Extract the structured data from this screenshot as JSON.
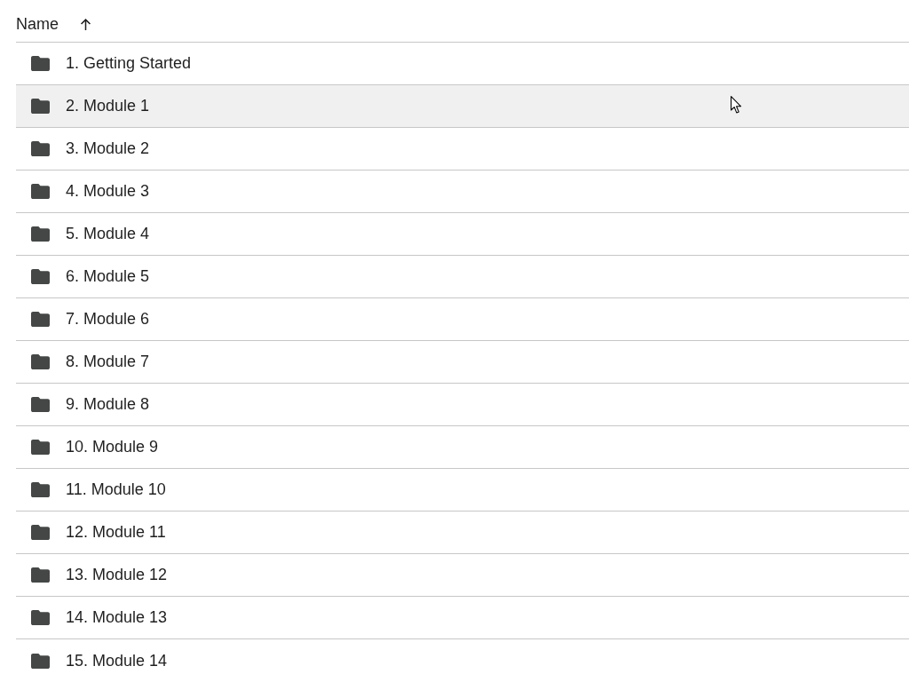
{
  "header": {
    "label": "Name",
    "sort_ascending": true
  },
  "rows": [
    {
      "name": "1. Getting Started",
      "hovered": false
    },
    {
      "name": "2. Module 1",
      "hovered": true
    },
    {
      "name": "3. Module 2",
      "hovered": false
    },
    {
      "name": "4. Module 3",
      "hovered": false
    },
    {
      "name": "5. Module 4",
      "hovered": false
    },
    {
      "name": "6. Module 5",
      "hovered": false
    },
    {
      "name": "7. Module 6",
      "hovered": false
    },
    {
      "name": "8. Module 7",
      "hovered": false
    },
    {
      "name": "9. Module 8",
      "hovered": false
    },
    {
      "name": "10. Module 9",
      "hovered": false
    },
    {
      "name": "11. Module 10",
      "hovered": false
    },
    {
      "name": "12. Module 11",
      "hovered": false
    },
    {
      "name": "13. Module 12",
      "hovered": false
    },
    {
      "name": "14. Module 13",
      "hovered": false
    },
    {
      "name": "15. Module 14",
      "hovered": false
    }
  ]
}
